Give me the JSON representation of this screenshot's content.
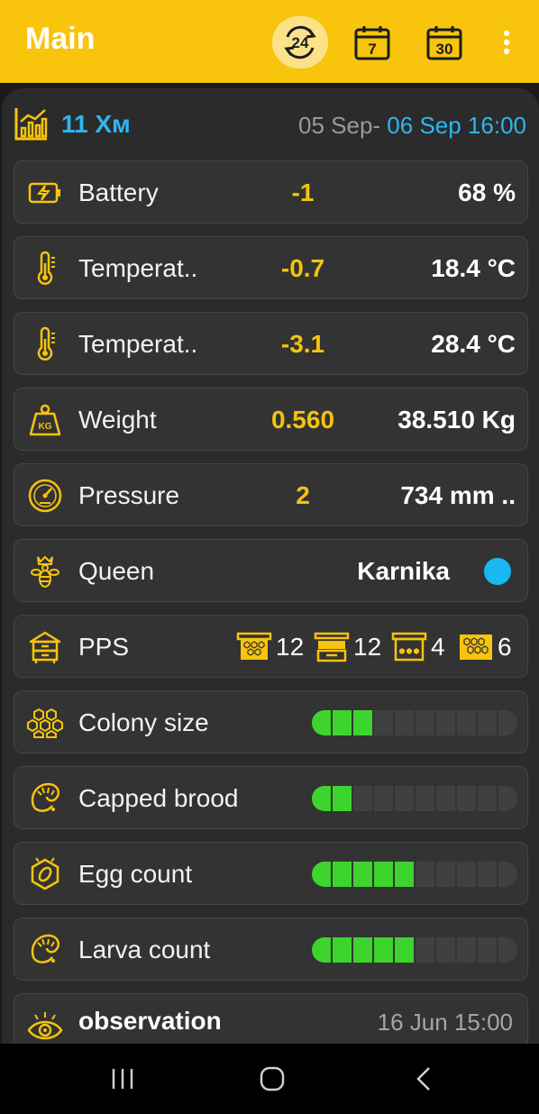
{
  "appbar": {
    "title": "Main",
    "buttons": [
      {
        "name": "period-24h-button",
        "label": "24",
        "icon": "refresh-24-icon",
        "active": true
      },
      {
        "name": "period-7d-button",
        "label": "7",
        "icon": "calendar-icon"
      },
      {
        "name": "period-30d-button",
        "label": "30",
        "icon": "calendar-icon"
      },
      {
        "name": "more-menu-button",
        "icon": "more-vertical-icon"
      }
    ]
  },
  "header": {
    "icon": "chart-icon",
    "hive_name": "11 Хм",
    "date_from": "05 Sep-",
    "date_to": " 06 Sep 16:00"
  },
  "metrics": [
    {
      "label": "Battery",
      "delta": "-1",
      "value": "68 %",
      "icon": "battery-charging-icon"
    },
    {
      "label": "Temperat..",
      "delta": "-0.7",
      "value": "18.4 °C",
      "icon": "thermometer-icon"
    },
    {
      "label": "Temperat..",
      "delta": "-3.1",
      "value": "28.4 °C",
      "icon": "thermometer-icon"
    },
    {
      "label": "Weight",
      "delta": "0.560",
      "value": "38.510 Kg",
      "icon": "weight-kg-icon"
    },
    {
      "label": "Pressure",
      "delta": "2",
      "value": "734 mm ..",
      "icon": "gauge-icon"
    }
  ],
  "queen": {
    "label": "Queen",
    "value": "Karnika",
    "icon": "queen-bee-icon",
    "dot_color": "#18b8f2"
  },
  "pps": {
    "label": "PPS",
    "icon": "hive-icon",
    "items": [
      {
        "icon": "frame-icon",
        "count": "12"
      },
      {
        "icon": "hive-box-icon",
        "count": "12"
      },
      {
        "icon": "frame-honey-icon",
        "count": "4"
      },
      {
        "icon": "honeycomb-icon",
        "count": "6"
      }
    ]
  },
  "levels": [
    {
      "label": "Colony size",
      "icon": "honeycomb-icon",
      "filled": 3,
      "total": 10
    },
    {
      "label": "Capped brood",
      "icon": "larva-icon",
      "filled": 2,
      "total": 10
    },
    {
      "label": "Egg count",
      "icon": "egg-icon",
      "filled": 5,
      "total": 10
    },
    {
      "label": "Larva count",
      "icon": "larva-icon",
      "filled": 5,
      "total": 10
    }
  ],
  "observation": {
    "label": "observation",
    "date": "16 Jun 15:00",
    "icon": "eye-icon"
  },
  "navbar": {
    "icons": [
      "recent-apps-icon",
      "home-icon",
      "back-icon"
    ]
  },
  "colors": {
    "accent": "#f8c40c",
    "highlight": "#2fb6f0",
    "level_on": "#3ed42e"
  }
}
